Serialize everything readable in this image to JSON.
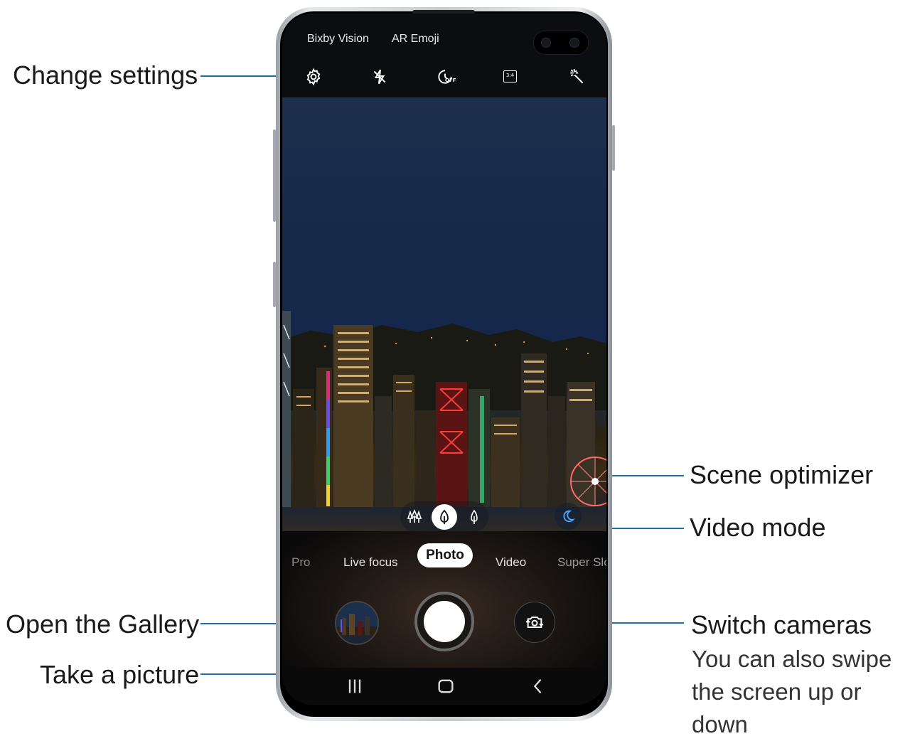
{
  "callouts": {
    "change_settings": "Change settings",
    "scene_optimizer": "Scene optimizer",
    "video_mode": "Video mode",
    "open_gallery": "Open the Gallery",
    "take_picture": "Take a picture",
    "switch_cameras": "Switch cameras",
    "switch_cameras_sub": [
      "You can also swipe",
      "the screen up or",
      "down"
    ]
  },
  "camera": {
    "top_modes": [
      "Bixby Vision",
      "AR Emoji"
    ],
    "top_icons": [
      "settings-gear-icon",
      "flash-off-icon",
      "timer-off-icon",
      "aspect-ratio-icon",
      "filters-sparkle-icon"
    ],
    "aspect_ratio_text": "3:4",
    "timer_text": "OFF",
    "modes": [
      "Pro",
      "Live focus",
      "Photo",
      "Video",
      "Super Slo"
    ],
    "selected_mode": "Photo",
    "focus_icons": [
      "wide-trees-icon",
      "standard-tree-icon",
      "tele-tree-icon"
    ],
    "scene_optimizer_icon": "moon-icon",
    "nav_icons": [
      "recents-icon",
      "home-icon",
      "back-icon"
    ]
  },
  "colors": {
    "leader": "#1b6fb3",
    "label_text": "#1a1a1a"
  }
}
